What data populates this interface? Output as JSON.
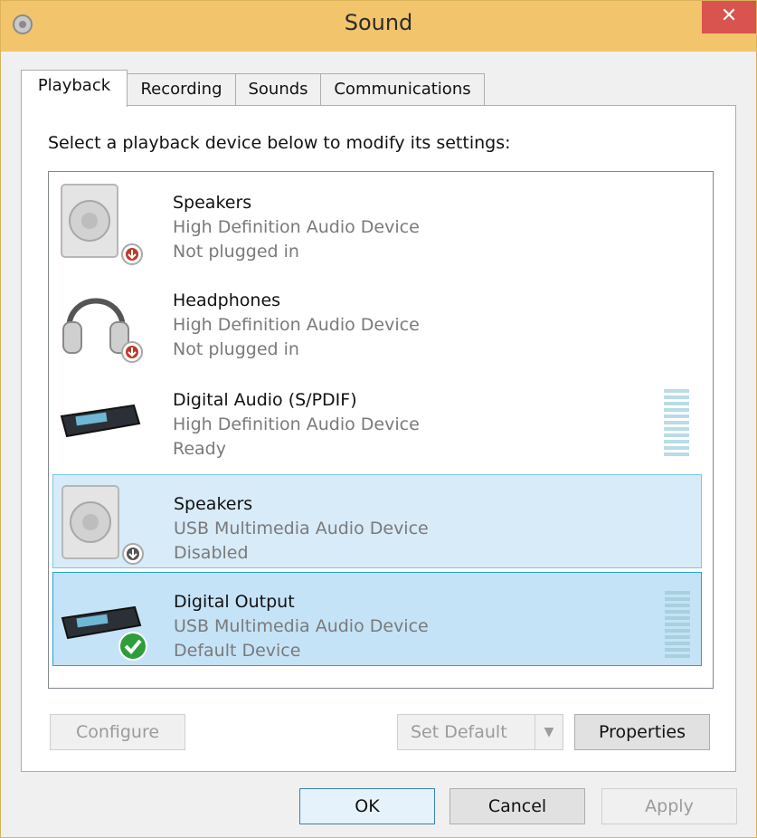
{
  "window": {
    "title": "Sound",
    "close_glyph": "✕"
  },
  "tabs": [
    {
      "label": "Playback",
      "active": true
    },
    {
      "label": "Recording",
      "active": false
    },
    {
      "label": "Sounds",
      "active": false
    },
    {
      "label": "Communications",
      "active": false
    }
  ],
  "instructions": "Select a playback device below to modify its settings:",
  "devices": [
    {
      "name": "Speakers",
      "description": "High Definition Audio Device",
      "status": "Not plugged in",
      "icon": "speaker-icon",
      "badge": "unplugged-badge-icon",
      "level_meter": false
    },
    {
      "name": "Headphones",
      "description": "High Definition Audio Device",
      "status": "Not plugged in",
      "icon": "headphones-icon",
      "badge": "unplugged-badge-icon",
      "level_meter": false
    },
    {
      "name": "Digital Audio (S/PDIF)",
      "description": "High Definition Audio Device",
      "status": "Ready",
      "icon": "digital-audio-icon",
      "badge": null,
      "level_meter": true
    },
    {
      "name": "Speakers",
      "description": "USB Multimedia Audio Device",
      "status": "Disabled",
      "icon": "speaker-icon",
      "badge": "disabled-badge-icon",
      "level_meter": false
    },
    {
      "name": "Digital Output",
      "description": "USB Multimedia Audio Device",
      "status": "Default Device",
      "icon": "digital-audio-icon",
      "badge": "default-check-icon",
      "level_meter": true
    }
  ],
  "buttons": {
    "configure": "Configure",
    "set_default": "Set Default",
    "properties": "Properties",
    "ok": "OK",
    "cancel": "Cancel",
    "apply": "Apply"
  },
  "colors": {
    "titlebar": "#f2c46c",
    "close": "#d9534f",
    "selection": "#d7ebf8",
    "meter": "#b9dce6"
  }
}
